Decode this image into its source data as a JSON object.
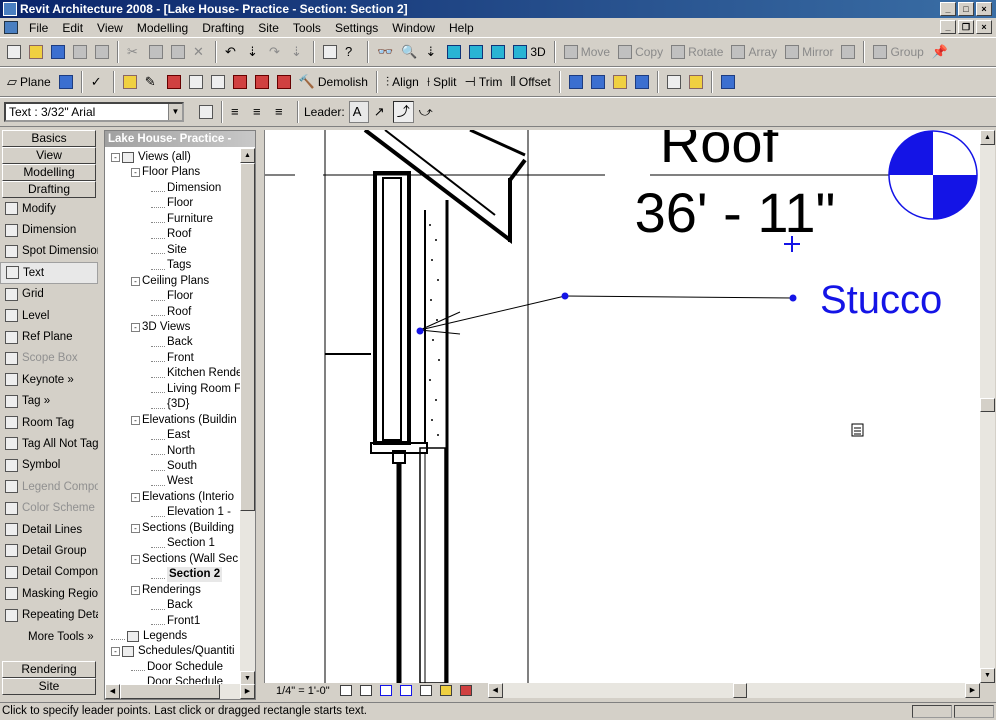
{
  "window": {
    "title": "Revit Architecture 2008 - [Lake House- Practice - Section: Section 2]"
  },
  "menu": [
    "File",
    "Edit",
    "View",
    "Modelling",
    "Drafting",
    "Site",
    "Tools",
    "Settings",
    "Window",
    "Help"
  ],
  "toolbar1": {
    "view_3d_label": "3D",
    "move": "Move",
    "copy": "Copy",
    "rotate": "Rotate",
    "array": "Array",
    "mirror": "Mirror",
    "group": "Group"
  },
  "toolbar2": {
    "plane": "Plane",
    "demolish": "Demolish",
    "align": "Align",
    "split": "Split",
    "trim": "Trim",
    "offset": "Offset"
  },
  "toolbar3": {
    "type_selector": "Text : 3/32\" Arial",
    "leader_label": "Leader:"
  },
  "design_bar": {
    "tabs_top": [
      "Basics",
      "View",
      "Modelling",
      "Drafting"
    ],
    "items": [
      {
        "label": "Modify",
        "icon": "arrow-icon",
        "enabled": true
      },
      {
        "label": "Dimension",
        "icon": "dimension-icon",
        "enabled": true
      },
      {
        "label": "Spot Dimension",
        "icon": "spot-dimension-icon",
        "enabled": true
      },
      {
        "label": "Text",
        "icon": "text-icon",
        "enabled": true,
        "selected": true
      },
      {
        "label": "Grid",
        "icon": "grid-icon",
        "enabled": true
      },
      {
        "label": "Level",
        "icon": "level-icon",
        "enabled": true
      },
      {
        "label": "Ref Plane",
        "icon": "ref-plane-icon",
        "enabled": true
      },
      {
        "label": "Scope Box",
        "icon": "scope-box-icon",
        "enabled": false
      },
      {
        "label": "Keynote »",
        "icon": "keynote-icon",
        "enabled": true
      },
      {
        "label": "Tag »",
        "icon": "tag-icon",
        "enabled": true
      },
      {
        "label": "Room Tag",
        "icon": "room-tag-icon",
        "enabled": true
      },
      {
        "label": "Tag All Not Tag",
        "icon": "tag-all-icon",
        "enabled": true
      },
      {
        "label": "Symbol",
        "icon": "symbol-icon",
        "enabled": true
      },
      {
        "label": "Legend Compor",
        "icon": "legend-icon",
        "enabled": false
      },
      {
        "label": "Color Scheme L",
        "icon": "color-scheme-icon",
        "enabled": false
      },
      {
        "label": "Detail Lines",
        "icon": "detail-lines-icon",
        "enabled": true
      },
      {
        "label": "Detail Group",
        "icon": "detail-group-icon",
        "enabled": true
      },
      {
        "label": "Detail Compone",
        "icon": "detail-component-icon",
        "enabled": true
      },
      {
        "label": "Masking Region",
        "icon": "masking-region-icon",
        "enabled": true
      },
      {
        "label": "Repeating Deta",
        "icon": "repeating-detail-icon",
        "enabled": true
      },
      {
        "label": "More Tools »",
        "icon": "",
        "enabled": true
      }
    ],
    "tabs_bottom": [
      "Rendering",
      "Site"
    ]
  },
  "browser": {
    "title": "Lake House- Practice -",
    "tree": [
      {
        "label": "Views (all)",
        "level": 0,
        "toggle": "-",
        "icon": "eye-icon"
      },
      {
        "label": "Floor Plans",
        "level": 1,
        "toggle": "-"
      },
      {
        "label": "Dimension",
        "level": 2
      },
      {
        "label": "Floor",
        "level": 2
      },
      {
        "label": "Furniture",
        "level": 2
      },
      {
        "label": "Roof",
        "level": 2
      },
      {
        "label": "Site",
        "level": 2
      },
      {
        "label": "Tags",
        "level": 2
      },
      {
        "label": "Ceiling Plans",
        "level": 1,
        "toggle": "-"
      },
      {
        "label": "Floor",
        "level": 2
      },
      {
        "label": "Roof",
        "level": 2
      },
      {
        "label": "3D Views",
        "level": 1,
        "toggle": "-"
      },
      {
        "label": "Back",
        "level": 2
      },
      {
        "label": "Front",
        "level": 2
      },
      {
        "label": "Kitchen Rende",
        "level": 2
      },
      {
        "label": "Living Room F",
        "level": 2
      },
      {
        "label": "{3D}",
        "level": 2
      },
      {
        "label": "Elevations (Buildin",
        "level": 1,
        "toggle": "-"
      },
      {
        "label": "East",
        "level": 2
      },
      {
        "label": "North",
        "level": 2
      },
      {
        "label": "South",
        "level": 2
      },
      {
        "label": "West",
        "level": 2
      },
      {
        "label": "Elevations (Interio",
        "level": 1,
        "toggle": "-"
      },
      {
        "label": "Elevation 1 -",
        "level": 2
      },
      {
        "label": "Sections (Building",
        "level": 1,
        "toggle": "-"
      },
      {
        "label": "Section 1",
        "level": 2
      },
      {
        "label": "Sections (Wall Sec",
        "level": 1,
        "toggle": "-"
      },
      {
        "label": "Section 2",
        "level": 2,
        "highlight": true
      },
      {
        "label": "Renderings",
        "level": 1,
        "toggle": "-"
      },
      {
        "label": "Back",
        "level": 2
      },
      {
        "label": "Front1",
        "level": 2
      },
      {
        "label": "Legends",
        "level": 0,
        "icon": "legends-icon"
      },
      {
        "label": "Schedules/Quantiti",
        "level": 0,
        "toggle": "-",
        "icon": "schedule-icon"
      },
      {
        "label": "Door Schedule",
        "level": 1
      },
      {
        "label": "Door Schedule",
        "level": 1
      }
    ]
  },
  "canvas": {
    "level_name": "Roof",
    "level_elevation": "36' - 11\"",
    "note_text": "Stucco",
    "accent": "#1414e6"
  },
  "view_control": {
    "scale": "1/4\" = 1'-0\""
  },
  "status": {
    "text": "Click to specify leader points.  Last click or dragged rectangle starts text."
  }
}
